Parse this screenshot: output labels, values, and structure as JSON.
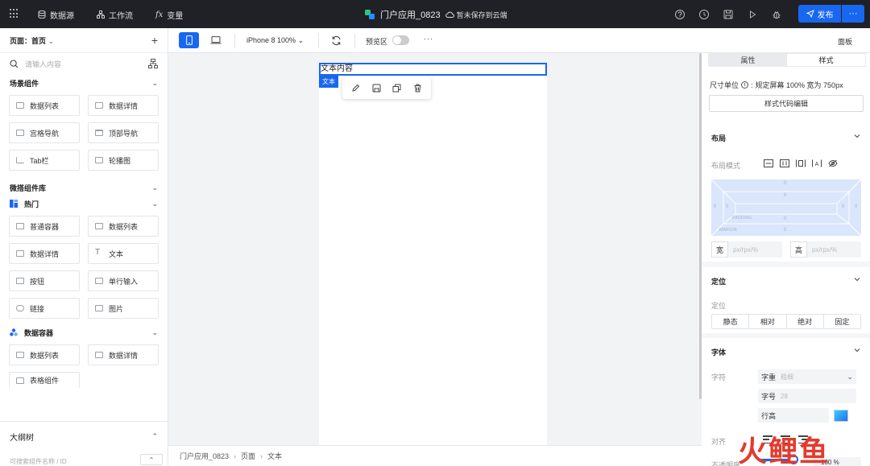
{
  "topbar": {
    "nav": [
      {
        "label": "数据源",
        "icon": "database-icon"
      },
      {
        "label": "工作流",
        "icon": "workflow-icon"
      },
      {
        "label": "变量",
        "icon": "function-icon"
      }
    ],
    "app_title": "门户应用_0823",
    "save_status": "暂未保存到云端",
    "publish_label": "发布",
    "more_label": "···"
  },
  "left": {
    "page_label": "页面：首页",
    "search_placeholder": "请输入内容",
    "scene_section": "场景组件",
    "scene_items": [
      "数据列表",
      "数据详情",
      "宫格导航",
      "顶部导航",
      "Tab栏",
      "轮播图"
    ],
    "micro_section": "微搭组件库",
    "hot_group": "热门",
    "hot_items": [
      "普通容器",
      "数据列表",
      "数据详情",
      "文本",
      "按钮",
      "单行输入",
      "链接",
      "图片"
    ],
    "data_group": "数据容器",
    "data_items": [
      "数据列表",
      "数据详情",
      "表格组件"
    ],
    "outline_title": "大纲树",
    "outline_search_placeholder": "可搜索组件名称 / ID"
  },
  "toolbar": {
    "device_label": "iPhone 8 100%",
    "preview_label": "预览区",
    "more": "···",
    "panel_label": "面板"
  },
  "canvas": {
    "text_content": "文本内容",
    "selection_tag": "文本"
  },
  "breadcrumb": [
    "门户应用_0823",
    "页面",
    "文本"
  ],
  "right": {
    "tab_props": "属性",
    "tab_style": "样式",
    "unit_label": "尺寸单位",
    "unit_value": "规定屏幕 100% 宽为 750px",
    "code_edit": "样式代码编辑",
    "layout_title": "布局",
    "layout_mode_label": "布局模式",
    "box_zero": "0",
    "padding_label": "PADDING",
    "margin_label": "MARGIN",
    "width_label": "宽",
    "height_label": "高",
    "size_placeholder": "px/rpx/%",
    "position_title": "定位",
    "position_label": "定位",
    "position_options": [
      "静态",
      "相对",
      "绝对",
      "固定"
    ],
    "font_title": "字体",
    "font_label": "字符",
    "weight_label": "字重",
    "weight_value": "粗细",
    "size_label": "字号",
    "size_value": "28",
    "lineheight_label": "行高",
    "align_label": "对齐",
    "opacity_label": "不透明度",
    "opacity_value": "100 %"
  },
  "watermark": "火鲤鱼",
  "colors": {
    "accent": "#1867f0",
    "topbar": "#1f2126"
  }
}
